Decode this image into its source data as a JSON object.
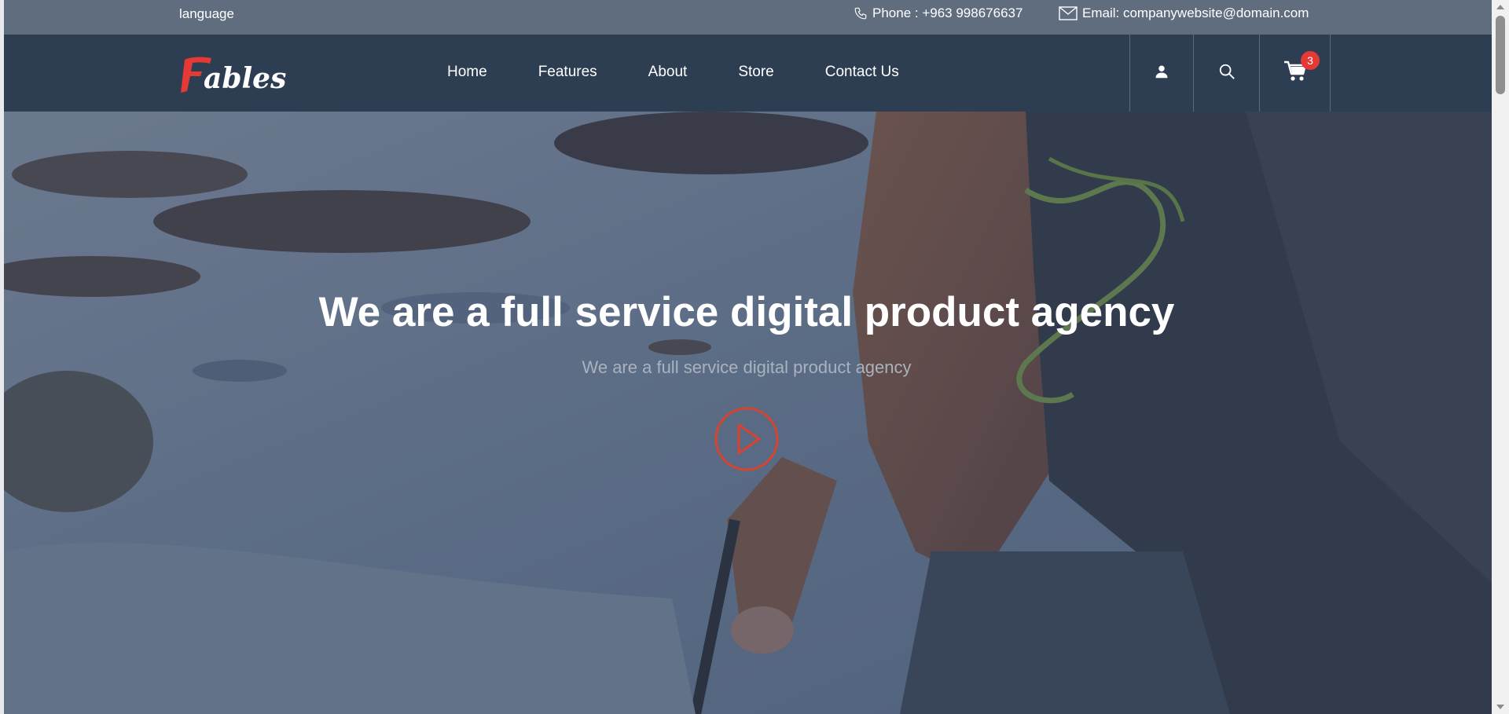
{
  "topbar": {
    "language_label": "language",
    "phone_text": "Phone : +963 998676637",
    "email_text": "Email: companywebsite@domain.com"
  },
  "nav": {
    "logo_text": "Fables",
    "links": [
      "Home",
      "Features",
      "About",
      "Store",
      "Contact Us"
    ],
    "cart_count": "3"
  },
  "hero": {
    "title": "We are a full service digital product agency",
    "subtitle": "We are a full service digital product agency"
  },
  "colors": {
    "topbar_bg": "#5f6d7f",
    "nav_bg": "#2e3e52",
    "accent_red": "#e53935",
    "play_red": "#d8432f"
  },
  "icons": [
    "phone-icon",
    "mail-icon",
    "user-icon",
    "search-icon",
    "cart-icon",
    "play-icon"
  ]
}
